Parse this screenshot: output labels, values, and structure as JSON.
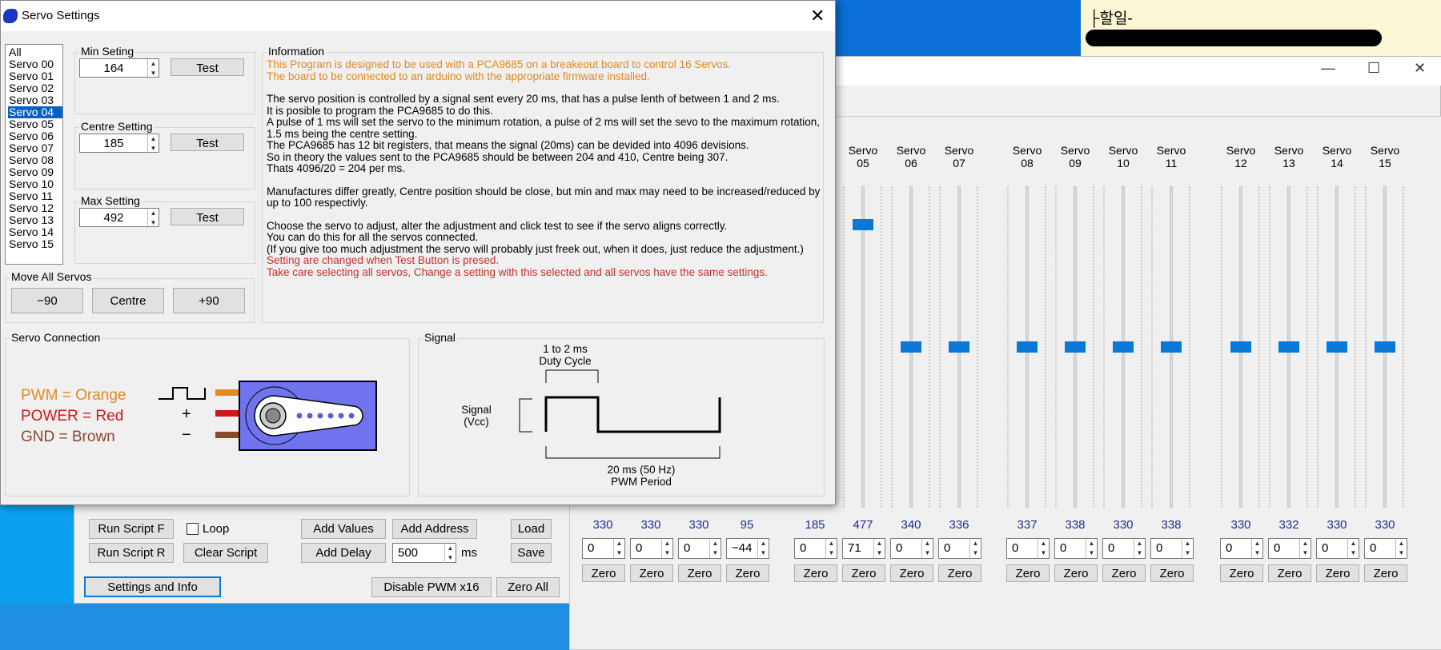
{
  "sticky": {
    "title": "├할일-"
  },
  "dialog": {
    "title": "Servo Settings",
    "servo_list": [
      "All",
      "Servo 00",
      "Servo 01",
      "Servo 02",
      "Servo 03",
      "Servo 04",
      "Servo 05",
      "Servo 06",
      "Servo 07",
      "Servo 08",
      "Servo 09",
      "Servo 10",
      "Servo 11",
      "Servo 12",
      "Servo 13",
      "Servo 14",
      "Servo 15"
    ],
    "selected_servo": "Servo 04",
    "min": {
      "label": "Min Seting",
      "value": "164",
      "test": "Test"
    },
    "centre": {
      "label": "Centre Setting",
      "value": "185",
      "test": "Test"
    },
    "max": {
      "label": "Max Setting",
      "value": "492",
      "test": "Test"
    },
    "move_all": {
      "label": "Move All Servos",
      "minus": "−90",
      "centre": "Centre",
      "plus": "+90"
    },
    "info": {
      "label": "Information",
      "l1": "This Program is designed to be used with a PCA9685 on a breakeout board to control 16 Servos.",
      "l2": "The board to be connected to an arduino with the appropriate firmware installed.",
      "p1": "The servo position is controlled by a signal sent every 20 ms, that has a pulse lenth of between 1 and 2 ms.",
      "p2": "It is posible to program the PCA9685 to do this.",
      "p3": "A pulse of 1 ms will set the servo to the minimum rotation, a pulse of 2 ms will set the sevo to the maximum rotation, 1.5 ms being the centre setting.",
      "p4": "The PCA9685 has 12 bit registers, that means the signal (20ms) can be devided into 4096 devisions.",
      "p5": "So in theory the values sent to the PCA9685 should be between  204 and 410, Centre being 307.",
      "p6": "Thats 4096/20 = 204 per ms.",
      "p7": "Manufactures differ greatly, Centre position should be close, but min and max may need to be increased/reduced by up to 100 respectivly.",
      "p8": "Choose the servo to adjust, alter the adjustment and click test to see if the servo aligns correctly.",
      "p9": "You can do this for all the servos connected.",
      "p10": "(If you give too much adjustment the servo will probably just freek out, when it does, just reduce the adjustment.)",
      "r1": "Setting are changed when Test Button is presed.",
      "r2": "Take care selecting all servos, Change a setting with this selected and all servos have the same settings."
    },
    "connection": {
      "label": "Servo Connection",
      "pwm": "PWM = Orange",
      "power": "POWER = Red",
      "gnd": "GND = Brown",
      "plus": "+",
      "minus": "−"
    },
    "signal": {
      "label": "Signal",
      "duty1": "1 to 2 ms",
      "duty2": "Duty Cycle",
      "sig1": "Signal",
      "sig2": "(Vcc)",
      "period1": "20 ms (50 Hz)",
      "period2": "PWM Period"
    }
  },
  "main": {
    "servos": [
      {
        "h1": "Servo",
        "h2": "05",
        "val": "477",
        "pos": "71",
        "thumb": 0.12
      },
      {
        "h1": "Servo",
        "h2": "06",
        "val": "340",
        "pos": "0",
        "thumb": 0.5
      },
      {
        "h1": "Servo",
        "h2": "07",
        "val": "336",
        "pos": "0",
        "thumb": 0.5
      },
      {
        "h1": "Servo",
        "h2": "08",
        "val": "337",
        "pos": "0",
        "thumb": 0.5
      },
      {
        "h1": "Servo",
        "h2": "09",
        "val": "338",
        "pos": "0",
        "thumb": 0.5
      },
      {
        "h1": "Servo",
        "h2": "10",
        "val": "330",
        "pos": "0",
        "thumb": 0.5
      },
      {
        "h1": "Servo",
        "h2": "11",
        "val": "338",
        "pos": "0",
        "thumb": 0.5
      },
      {
        "h1": "Servo",
        "h2": "12",
        "val": "330",
        "pos": "0",
        "thumb": 0.5
      },
      {
        "h1": "Servo",
        "h2": "13",
        "val": "332",
        "pos": "0",
        "thumb": 0.5
      },
      {
        "h1": "Servo",
        "h2": "14",
        "val": "330",
        "pos": "0",
        "thumb": 0.5
      },
      {
        "h1": "Servo",
        "h2": "15",
        "val": "330",
        "pos": "0",
        "thumb": 0.5
      }
    ],
    "left_servos": [
      {
        "val": "330",
        "pos": "0"
      },
      {
        "val": "330",
        "pos": "0"
      },
      {
        "val": "330",
        "pos": "0"
      },
      {
        "val": "95",
        "pos": "−44"
      },
      {
        "val": "185",
        "pos": "0"
      }
    ],
    "zero": "Zero",
    "run_script_f": "Run Script F",
    "loop": "Loop",
    "add_values": "Add Values",
    "add_address": "Add Address",
    "load": "Load",
    "run_script_r": "Run Script R",
    "clear_script": "Clear Script",
    "add_delay": "Add Delay",
    "delay_value": "500",
    "ms": "ms",
    "save": "Save",
    "settings_info": "Settings and Info",
    "disable_pwm": "Disable PWM x16",
    "zero_all": "Zero All"
  }
}
